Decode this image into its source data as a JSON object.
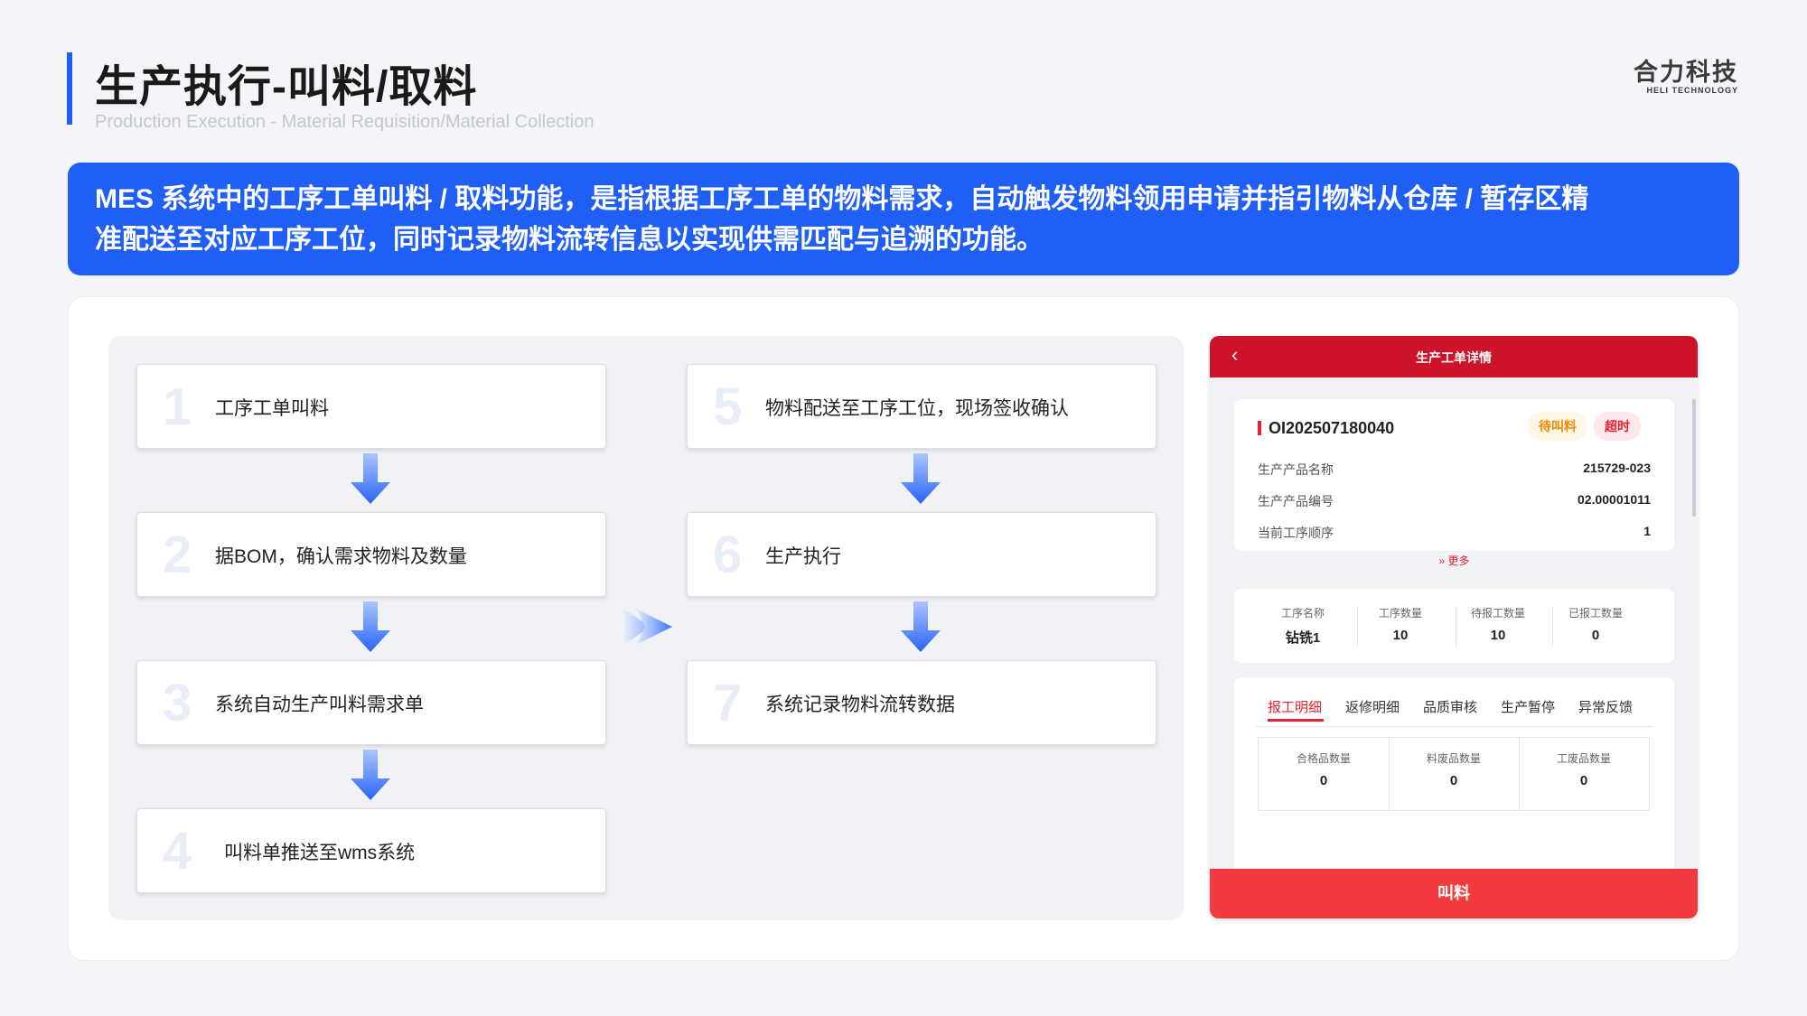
{
  "header": {
    "title": "生产执行-叫料/取料",
    "subtitle": "Production Execution - Material Requisition/Material Collection",
    "logo_cn": "合力科技",
    "logo_en": "HELI TECHNOLOGY"
  },
  "banner": {
    "line1": "MES 系统中的工序工单叫料 / 取料功能，是指根据工序工单的物料需求，自动触发物料领用申请并指引物料从仓库 / 暂存区精",
    "line2": "准配送至对应工序工位，同时记录物料流转信息以实现供需匹配与追溯的功能。"
  },
  "colors": {
    "accent_blue": "#1f5ff5",
    "brand_red": "#cc1327",
    "button_red": "#f33b3f",
    "status_orange": "#f08c00"
  },
  "steps": [
    {
      "num": "1",
      "text": "工序工单叫料"
    },
    {
      "num": "2",
      "text": "据BOM，确认需求物料及数量"
    },
    {
      "num": "3",
      "text": "系统自动生产叫料需求单"
    },
    {
      "num": "4",
      "text": "叫料单推送至wms系统"
    },
    {
      "num": "5",
      "text": "物料配送至工序工位，现场签收确认"
    },
    {
      "num": "6",
      "text": "生产执行"
    },
    {
      "num": "7",
      "text": "系统记录物料流转数据"
    }
  ],
  "phone": {
    "back_icon": "chevron-left-icon",
    "title": "生产工单详情",
    "order_no": "OI202507180040",
    "badge_wait": "待叫料",
    "badge_over": "超时",
    "info": [
      {
        "label": "生产产品名称",
        "value": "215729-023"
      },
      {
        "label": "生产产品编号",
        "value": "02.00001011"
      },
      {
        "label": "当前工序顺序",
        "value": "1"
      }
    ],
    "more": "更多",
    "qty": [
      {
        "label": "工序名称",
        "value": "钻铣1"
      },
      {
        "label": "工序数量",
        "value": "10"
      },
      {
        "label": "待报工数量",
        "value": "10"
      },
      {
        "label": "已报工数量",
        "value": "0"
      }
    ],
    "tabs": [
      "报工明细",
      "返修明细",
      "品质审核",
      "生产暂停",
      "异常反馈"
    ],
    "active_tab": "报工明细",
    "detail": [
      {
        "label": "合格品数量",
        "value": "0"
      },
      {
        "label": "料废品数量",
        "value": "0"
      },
      {
        "label": "工废品数量",
        "value": "0"
      }
    ],
    "button": "叫料"
  }
}
